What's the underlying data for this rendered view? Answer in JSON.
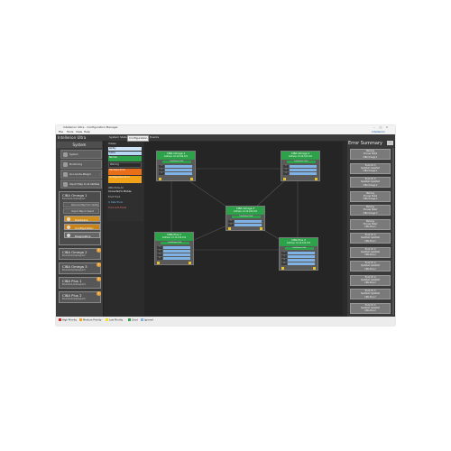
{
  "window": {
    "title": "Intellerion Ultra - Configuration Manager",
    "menu": [
      "File",
      "Tools",
      "View",
      "Help"
    ],
    "brand": "Intellerion"
  },
  "nav": {
    "crumb": "Intellerion Ultra",
    "tabs": [
      "System Status",
      "Configuration",
      "Events"
    ],
    "active_tab": "Configuration"
  },
  "sidebar": {
    "header": "System",
    "items": [
      {
        "label": "System",
        "icon": "system-icon"
      },
      {
        "label": "Monitoring",
        "icon": "monitor-icon"
      },
      {
        "label": "Go Live Re-Merger",
        "icon": "merge-icon"
      },
      {
        "label": "Import Map to all Abilities",
        "icon": "import-icon"
      }
    ],
    "cbx_expanded": {
      "name": "CIBA Omega 1",
      "sub": "Boarder1/Alpha/pin1"
    },
    "cbx_inner": [
      "Remove Map from Ability",
      "Import Map to Select"
    ],
    "subitems": [
      {
        "label": "Hardware",
        "color": "#d08e1f"
      },
      {
        "label": "Configuration",
        "color": "#c98316"
      },
      {
        "label": "Diagnostics",
        "color": "#666666"
      }
    ],
    "devices": [
      {
        "name": "CIBA Omega 2",
        "sub": "Boarder2/Alpha/pin2",
        "badge": "!"
      },
      {
        "name": "CIBA Omega 3",
        "sub": "Boarder3/Alpha/pin3",
        "badge": "!"
      },
      {
        "name": "CIBA Plus 1",
        "sub": "Boarder1/Alpha/pin4",
        "badge": "!"
      },
      {
        "name": "CIBA Plus 2",
        "sub": "Boarder2/Alpha/pin5",
        "badge": "!"
      }
    ]
  },
  "legend": {
    "title": "Views",
    "rows": [
      {
        "label": "Ability",
        "color": "#cfe4f7"
      },
      {
        "label": "Cable",
        "color": "#b7d7f2"
      },
      {
        "label": "Normal",
        "color": "#2ea24a"
      },
      {
        "label": "Warning",
        "color": "#2c2c2c"
      },
      {
        "label": "Hardware Error",
        "color": "#e86e1a"
      },
      {
        "label": "Configuration Error",
        "color": "#f2a219"
      }
    ],
    "notes": [
      "CIBA Mode Air",
      "Connected to Module",
      "Front Trunk",
      "In Data Trunk",
      "Trunk with Faults"
    ]
  },
  "nodes": [
    {
      "title": "CIBA Omega 1",
      "sub": "Address: 10.10.100.101",
      "mode": "Intellerion Unit",
      "ports": [
        "1",
        "2",
        "3"
      ]
    },
    {
      "title": "CIBA Omega 2",
      "sub": "Address: 10.10.100.102",
      "mode": "Intellerion Unit",
      "ports": [
        "1",
        "2",
        "3"
      ]
    },
    {
      "title": "CIBA Omega 3",
      "sub": "Address: 10.10.100.103",
      "mode": "Intellerion Unit",
      "ports": [
        "1",
        "2"
      ]
    },
    {
      "title": "CIBA Plus 1",
      "sub": "Address: 10.10.100.104",
      "mode": "Intellerion Unit",
      "ports": [
        "1",
        "2",
        "3",
        "4"
      ]
    },
    {
      "title": "CIBA Plus 2",
      "sub": "Address: 10.10.100.105",
      "mode": "Intellerion Unit",
      "ports": [
        "1",
        "2",
        "3",
        "4"
      ]
    }
  ],
  "error_summary": {
    "title": "Error Summary",
    "button": "‹›",
    "cards": [
      {
        "l1": "Warning",
        "l2": "Process Failed",
        "l3": "CIBA Omega 1"
      },
      {
        "l1": "Trunk ID: 0",
        "l2": "Spell/Set: Spell/Set",
        "l3": "CIBA Omega 1"
      },
      {
        "l1": "Trunk ID: 0",
        "l2": "Spell/Set: Spell/Set",
        "l3": "CIBA Omega 2"
      },
      {
        "l1": "Warning",
        "l2": "Process Failed",
        "l3": "CIBA Omega 2"
      },
      {
        "l1": "Warning",
        "l2": "Process Failed",
        "l3": "CIBA Omega 3"
      },
      {
        "l1": "Warning",
        "l2": "Process Failed",
        "l3": "CIBA Plus 1"
      },
      {
        "l1": "Trunk ID: 0",
        "l2": "Spell/Set: Spell/Set",
        "l3": "CIBA Plus 1"
      },
      {
        "l1": "Trunk ID: 0",
        "l2": "Spell/Set: Spell/Set",
        "l3": "CIBA Plus 2"
      },
      {
        "l1": "Trunk ID: 0",
        "l2": "Spell/Set: Spell/Set",
        "l3": "CIBA Plus 2"
      },
      {
        "l1": "Trunk ID: 0",
        "l2": "Spell/Set: Spell/Set",
        "l3": "CIBA Plus 2"
      },
      {
        "l1": "Trunk ID: 0",
        "l2": "Spell/Set: Spell/Set",
        "l3": "CIBA Plus 2"
      },
      {
        "l1": "Trunk ID: 0",
        "l2": "Spell/Set: Spell/Set",
        "l3": "CIBA Plus 2"
      }
    ]
  },
  "status_bar": [
    {
      "label": "High Priority",
      "color": "#d9261c"
    },
    {
      "label": "Medium Priority",
      "color": "#f2a219"
    },
    {
      "label": "Low Priority",
      "color": "#f2e419"
    },
    {
      "label": "Good",
      "color": "#2ea24a"
    },
    {
      "label": "Ignored",
      "color": "#7fb2e5"
    }
  ]
}
